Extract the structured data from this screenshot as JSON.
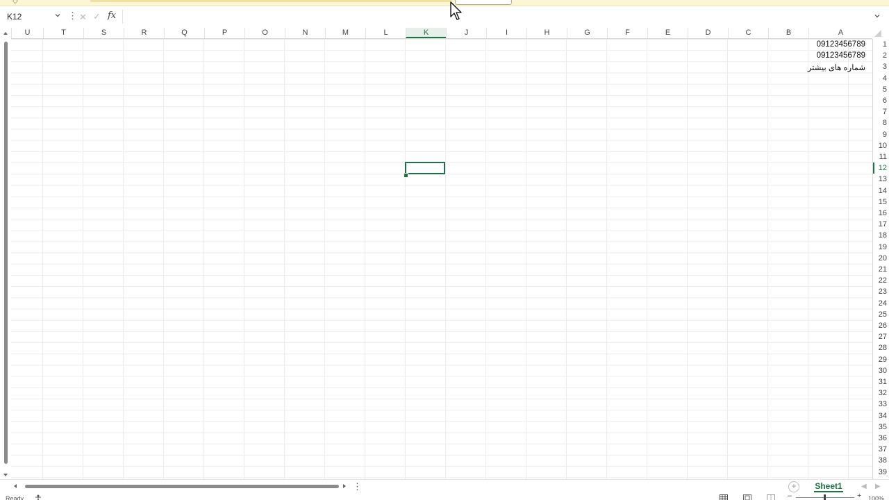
{
  "formula_bar": {
    "name_box": "K12",
    "fx_label": "fx",
    "formula_value": ""
  },
  "columns": [
    {
      "letter": "U"
    },
    {
      "letter": "T"
    },
    {
      "letter": "S"
    },
    {
      "letter": "R"
    },
    {
      "letter": "Q"
    },
    {
      "letter": "P"
    },
    {
      "letter": "O"
    },
    {
      "letter": "N"
    },
    {
      "letter": "M"
    },
    {
      "letter": "L"
    },
    {
      "letter": "K",
      "selected": true
    },
    {
      "letter": "J"
    },
    {
      "letter": "I"
    },
    {
      "letter": "H"
    },
    {
      "letter": "G"
    },
    {
      "letter": "F"
    },
    {
      "letter": "E"
    },
    {
      "letter": "D"
    },
    {
      "letter": "C"
    },
    {
      "letter": "B"
    },
    {
      "letter": "A"
    }
  ],
  "rows": {
    "first": 1,
    "last": 39,
    "selected": 12
  },
  "cells": {
    "A1": "09123456789",
    "A2": "09123456789",
    "A3": "شماره های بیشتر"
  },
  "active_cell": "K12",
  "sheets": [
    {
      "name": "Sheet1",
      "active": true
    }
  ],
  "status": {
    "ready": "Ready",
    "zoom": "100%"
  },
  "colors": {
    "accent": "#1e7145",
    "banner": "#fdf6d5",
    "gridline": "#ececec"
  },
  "icons": [
    "cursor-arrow-icon",
    "chevron-down-icon",
    "more-options-icon",
    "cancel-icon",
    "enter-icon",
    "function-icon",
    "expand-icon",
    "add-sheet-icon",
    "normal-view-icon",
    "page-layout-icon",
    "page-break-icon",
    "accessibility-icon"
  ]
}
